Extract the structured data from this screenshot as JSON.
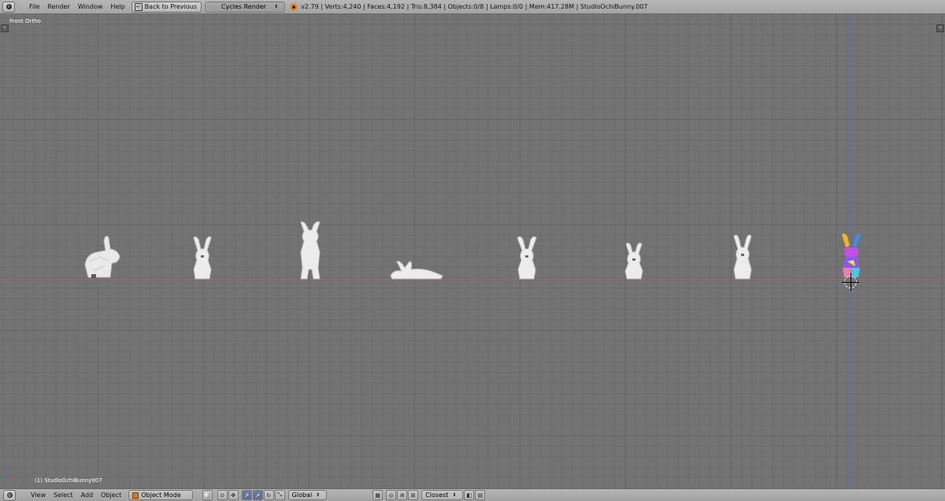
{
  "topbar": {
    "menus": [
      "File",
      "Render",
      "Window",
      "Help"
    ],
    "back_button": "Back to Previous",
    "render_engine": "Cycles Render",
    "stats": "v2.79 | Verts:4,240 | Faces:4,192 | Tris:8,384 | Objects:0/8 | Lamps:0/0 | Mem:417.28M | StudioOchiBunny.007"
  },
  "viewport": {
    "view_name": "Front Ortho",
    "active_object": "(1) StudioOchiBunny007"
  },
  "bottombar": {
    "menus": [
      "View",
      "Select",
      "Add",
      "Object"
    ],
    "mode": "Object Mode",
    "orientation": "Global",
    "snap_target": "Closest"
  },
  "icons": {
    "editor_type": "info-icon",
    "back": "back-arrow-icon",
    "blender_logo": "blender-logo-icon",
    "mode": "object-cube-icon",
    "shading": "solid-sphere-icon"
  },
  "colors": {
    "header": "#a8a8a8",
    "viewport_bg": "#737373",
    "x_axis": "#9a6a6a",
    "z_axis": "#5a6fb5",
    "active_button": "#6d7ea8"
  }
}
